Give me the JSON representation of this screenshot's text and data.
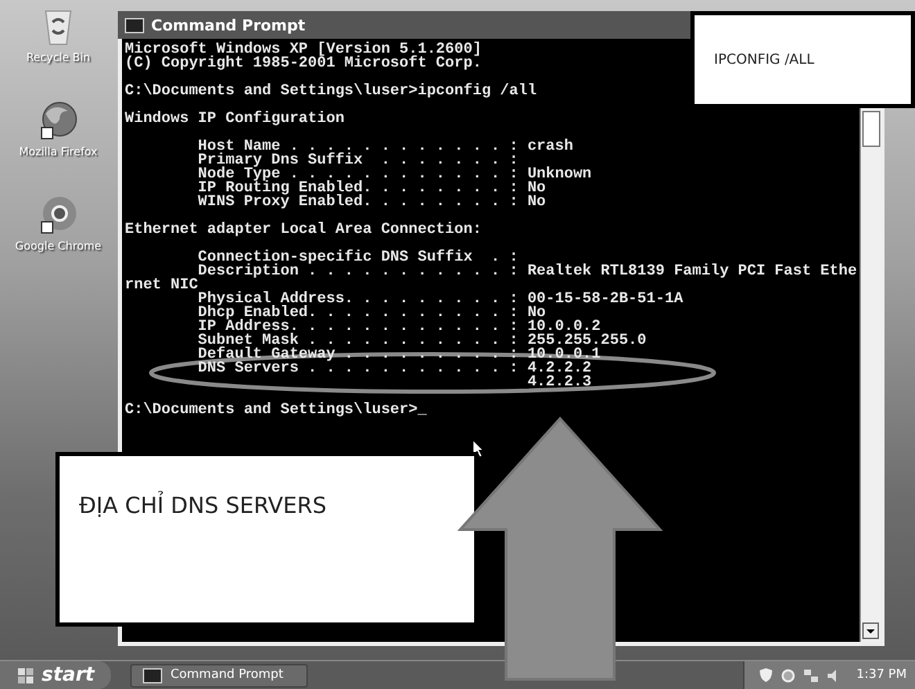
{
  "desktop_icons": [
    {
      "label": "Recycle Bin",
      "kind": "bin"
    },
    {
      "label": "Mozilla Firefox",
      "kind": "firefox"
    },
    {
      "label": "Google Chrome",
      "kind": "chrome"
    }
  ],
  "window": {
    "title": "Command Prompt",
    "console_blocks": [
      [
        "Microsoft Windows XP [Version 5.1.2600]",
        "(C) Copyright 1985-2001 Microsoft Corp."
      ],
      [
        "C:\\Documents and Settings\\luser>ipconfig /all"
      ],
      [
        "Windows IP Configuration"
      ],
      [
        "        Host Name . . . . . . . . . . . . : crash",
        "        Primary Dns Suffix  . . . . . . . :",
        "        Node Type . . . . . . . . . . . . : Unknown",
        "        IP Routing Enabled. . . . . . . . : No",
        "        WINS Proxy Enabled. . . . . . . . : No"
      ],
      [
        "Ethernet adapter Local Area Connection:"
      ],
      [
        "        Connection-specific DNS Suffix  . :",
        "        Description . . . . . . . . . . . : Realtek RTL8139 Family PCI Fast Ethe",
        "rnet NIC",
        "        Physical Address. . . . . . . . . : 00-15-58-2B-51-1A",
        "        Dhcp Enabled. . . . . . . . . . . : No",
        "        IP Address. . . . . . . . . . . . : 10.0.0.2",
        "        Subnet Mask . . . . . . . . . . . : 255.255.255.0",
        "        Default Gateway . . . . . . . . . : 10.0.0.1",
        "        DNS Servers . . . . . . . . . . . : 4.2.2.2",
        "                                            4.2.2.3"
      ],
      [
        "C:\\Documents and Settings\\luser>_"
      ]
    ]
  },
  "callouts": [
    {
      "text": "IPCONFIG /ALL",
      "kind": "top"
    },
    {
      "text": "ĐỊA CHỈ DNS SERVERS",
      "kind": "bottom"
    }
  ],
  "taskbar": {
    "start": "start",
    "tasks": [
      {
        "label": "Command Prompt",
        "selected": false
      }
    ],
    "clock": "1:37 PM"
  }
}
